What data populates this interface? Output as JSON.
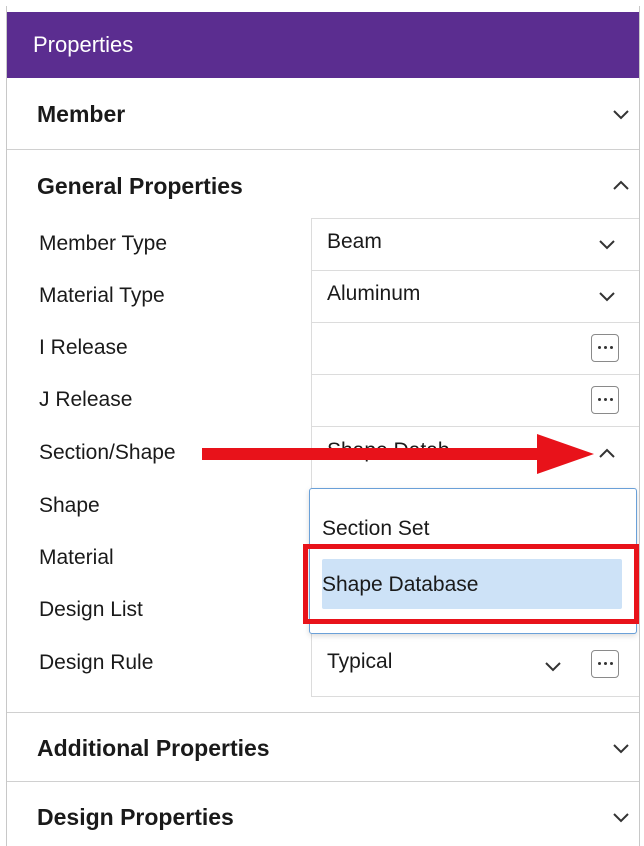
{
  "panel": {
    "title": "Properties"
  },
  "sections": {
    "member": {
      "label": "Member",
      "state": "collapsed"
    },
    "general": {
      "label": "General Properties",
      "state": "expanded"
    },
    "additional": {
      "label": "Additional Properties",
      "state": "collapsed"
    },
    "design": {
      "label": "Design Properties",
      "state": "collapsed"
    }
  },
  "properties": [
    {
      "label": "Member Type",
      "value": "Beam",
      "control": "dropdown"
    },
    {
      "label": "Material Type",
      "value": "Aluminum",
      "control": "dropdown"
    },
    {
      "label": "I Release",
      "value": "",
      "control": "ellipsis"
    },
    {
      "label": "J Release",
      "value": "",
      "control": "ellipsis"
    },
    {
      "label": "Section/Shape",
      "value": "Shape Datab",
      "control": "dropdown-open"
    },
    {
      "label": "Shape",
      "value": "",
      "control": "none"
    },
    {
      "label": "Material",
      "value": "",
      "control": "none"
    },
    {
      "label": "Design List",
      "value": "",
      "control": "ellipsis"
    },
    {
      "label": "Design Rule",
      "value": "Typical",
      "control": "dropdown-ellipsis"
    }
  ],
  "dropdown_options": [
    {
      "label": "Section Set",
      "selected": false
    },
    {
      "label": "Shape Database",
      "selected": true
    }
  ],
  "icons": {
    "chevron_down": "chevron-down-icon",
    "chevron_up": "chevron-up-icon",
    "ellipsis": "ellipsis-icon",
    "arrow": "arrow-right-annotation"
  },
  "colors": {
    "title_bar": "#5b2d90",
    "annotation_red": "#e8121a",
    "selected_option": "#cde2f7",
    "dropdown_border": "#6aa0d8"
  }
}
